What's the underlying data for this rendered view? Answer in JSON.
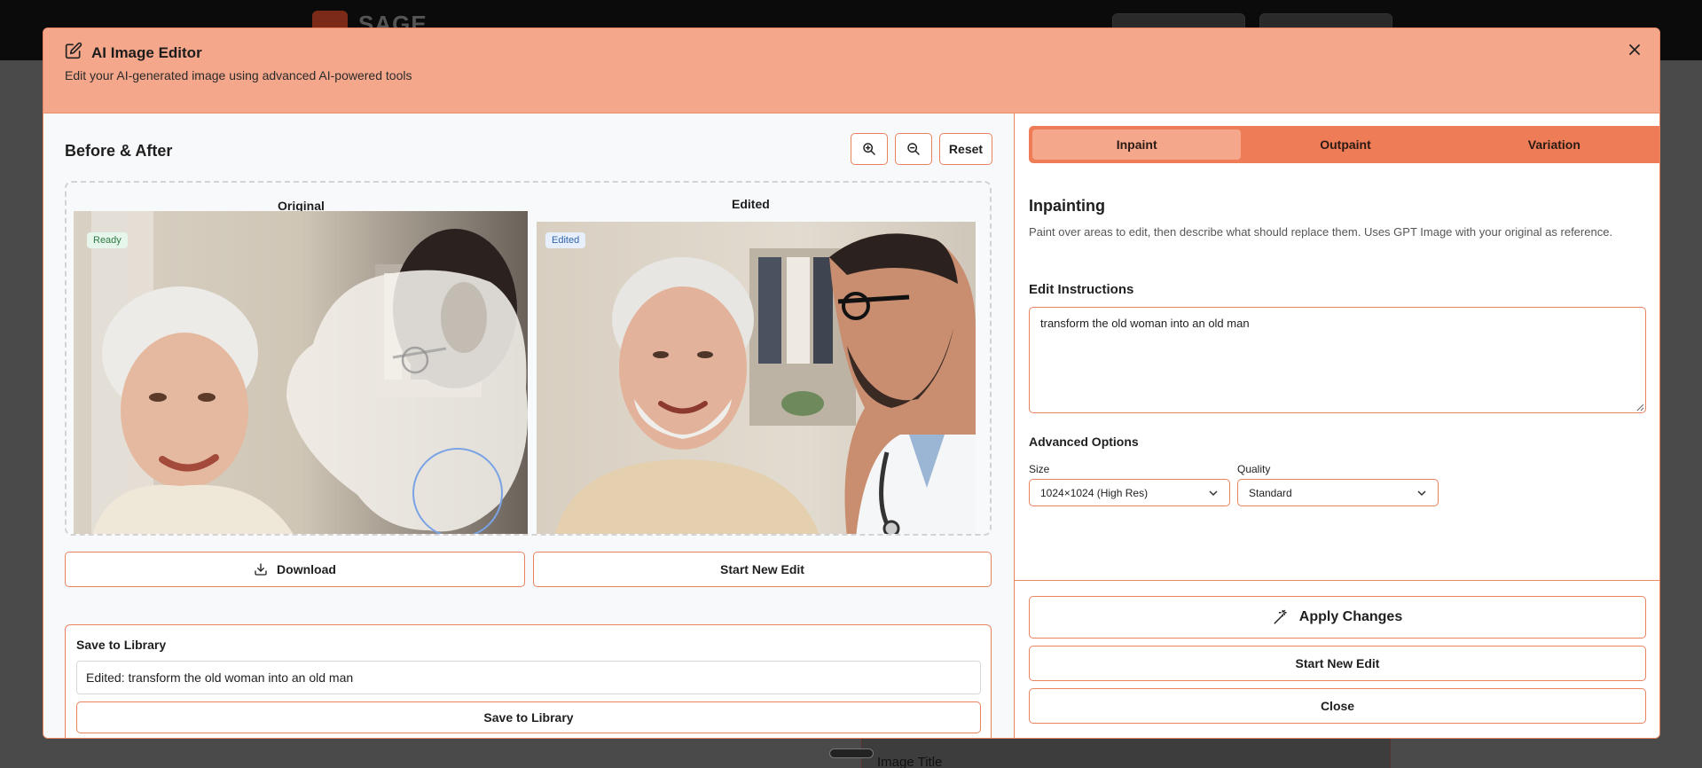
{
  "background": {
    "logo_text": "SAGE",
    "image_title_label": "Image Title"
  },
  "modal": {
    "title": "AI Image Editor",
    "subtitle": "Edit your AI-generated image using advanced AI-powered tools",
    "icons": {
      "title": "edit-icon",
      "close": "close-icon"
    }
  },
  "compare": {
    "title": "Before & After",
    "reset_label": "Reset",
    "original_label": "Original",
    "edited_label": "Edited",
    "original_badge": "Ready",
    "edited_badge": "Edited"
  },
  "actions": {
    "download_label": "Download",
    "start_new_edit_label": "Start New Edit"
  },
  "save": {
    "title": "Save to Library",
    "input_value": "Edited: transform the old woman into an old man",
    "button_label": "Save to Library"
  },
  "tabs": [
    {
      "label": "Inpaint",
      "active": true
    },
    {
      "label": "Outpaint",
      "active": false
    },
    {
      "label": "Variation",
      "active": false
    }
  ],
  "inpaint": {
    "title": "Inpainting",
    "description": "Paint over areas to edit, then describe what should replace them. Uses GPT Image with your original as reference.",
    "instructions_label": "Edit Instructions",
    "instructions_value": "transform the old woman into an old man",
    "advanced_title": "Advanced Options",
    "size_label": "Size",
    "size_value": "1024×1024 (High Res)",
    "quality_label": "Quality",
    "quality_value": "Standard"
  },
  "footer": {
    "apply_label": "Apply Changes",
    "start_new_edit_label": "Start New Edit",
    "close_label": "Close"
  },
  "colors": {
    "header": "#f5a78b",
    "accent_border": "#e8825f",
    "tab_bar": "#ee7c57",
    "ready_badge": "#e6f6ea",
    "edited_badge": "#e6effb"
  }
}
